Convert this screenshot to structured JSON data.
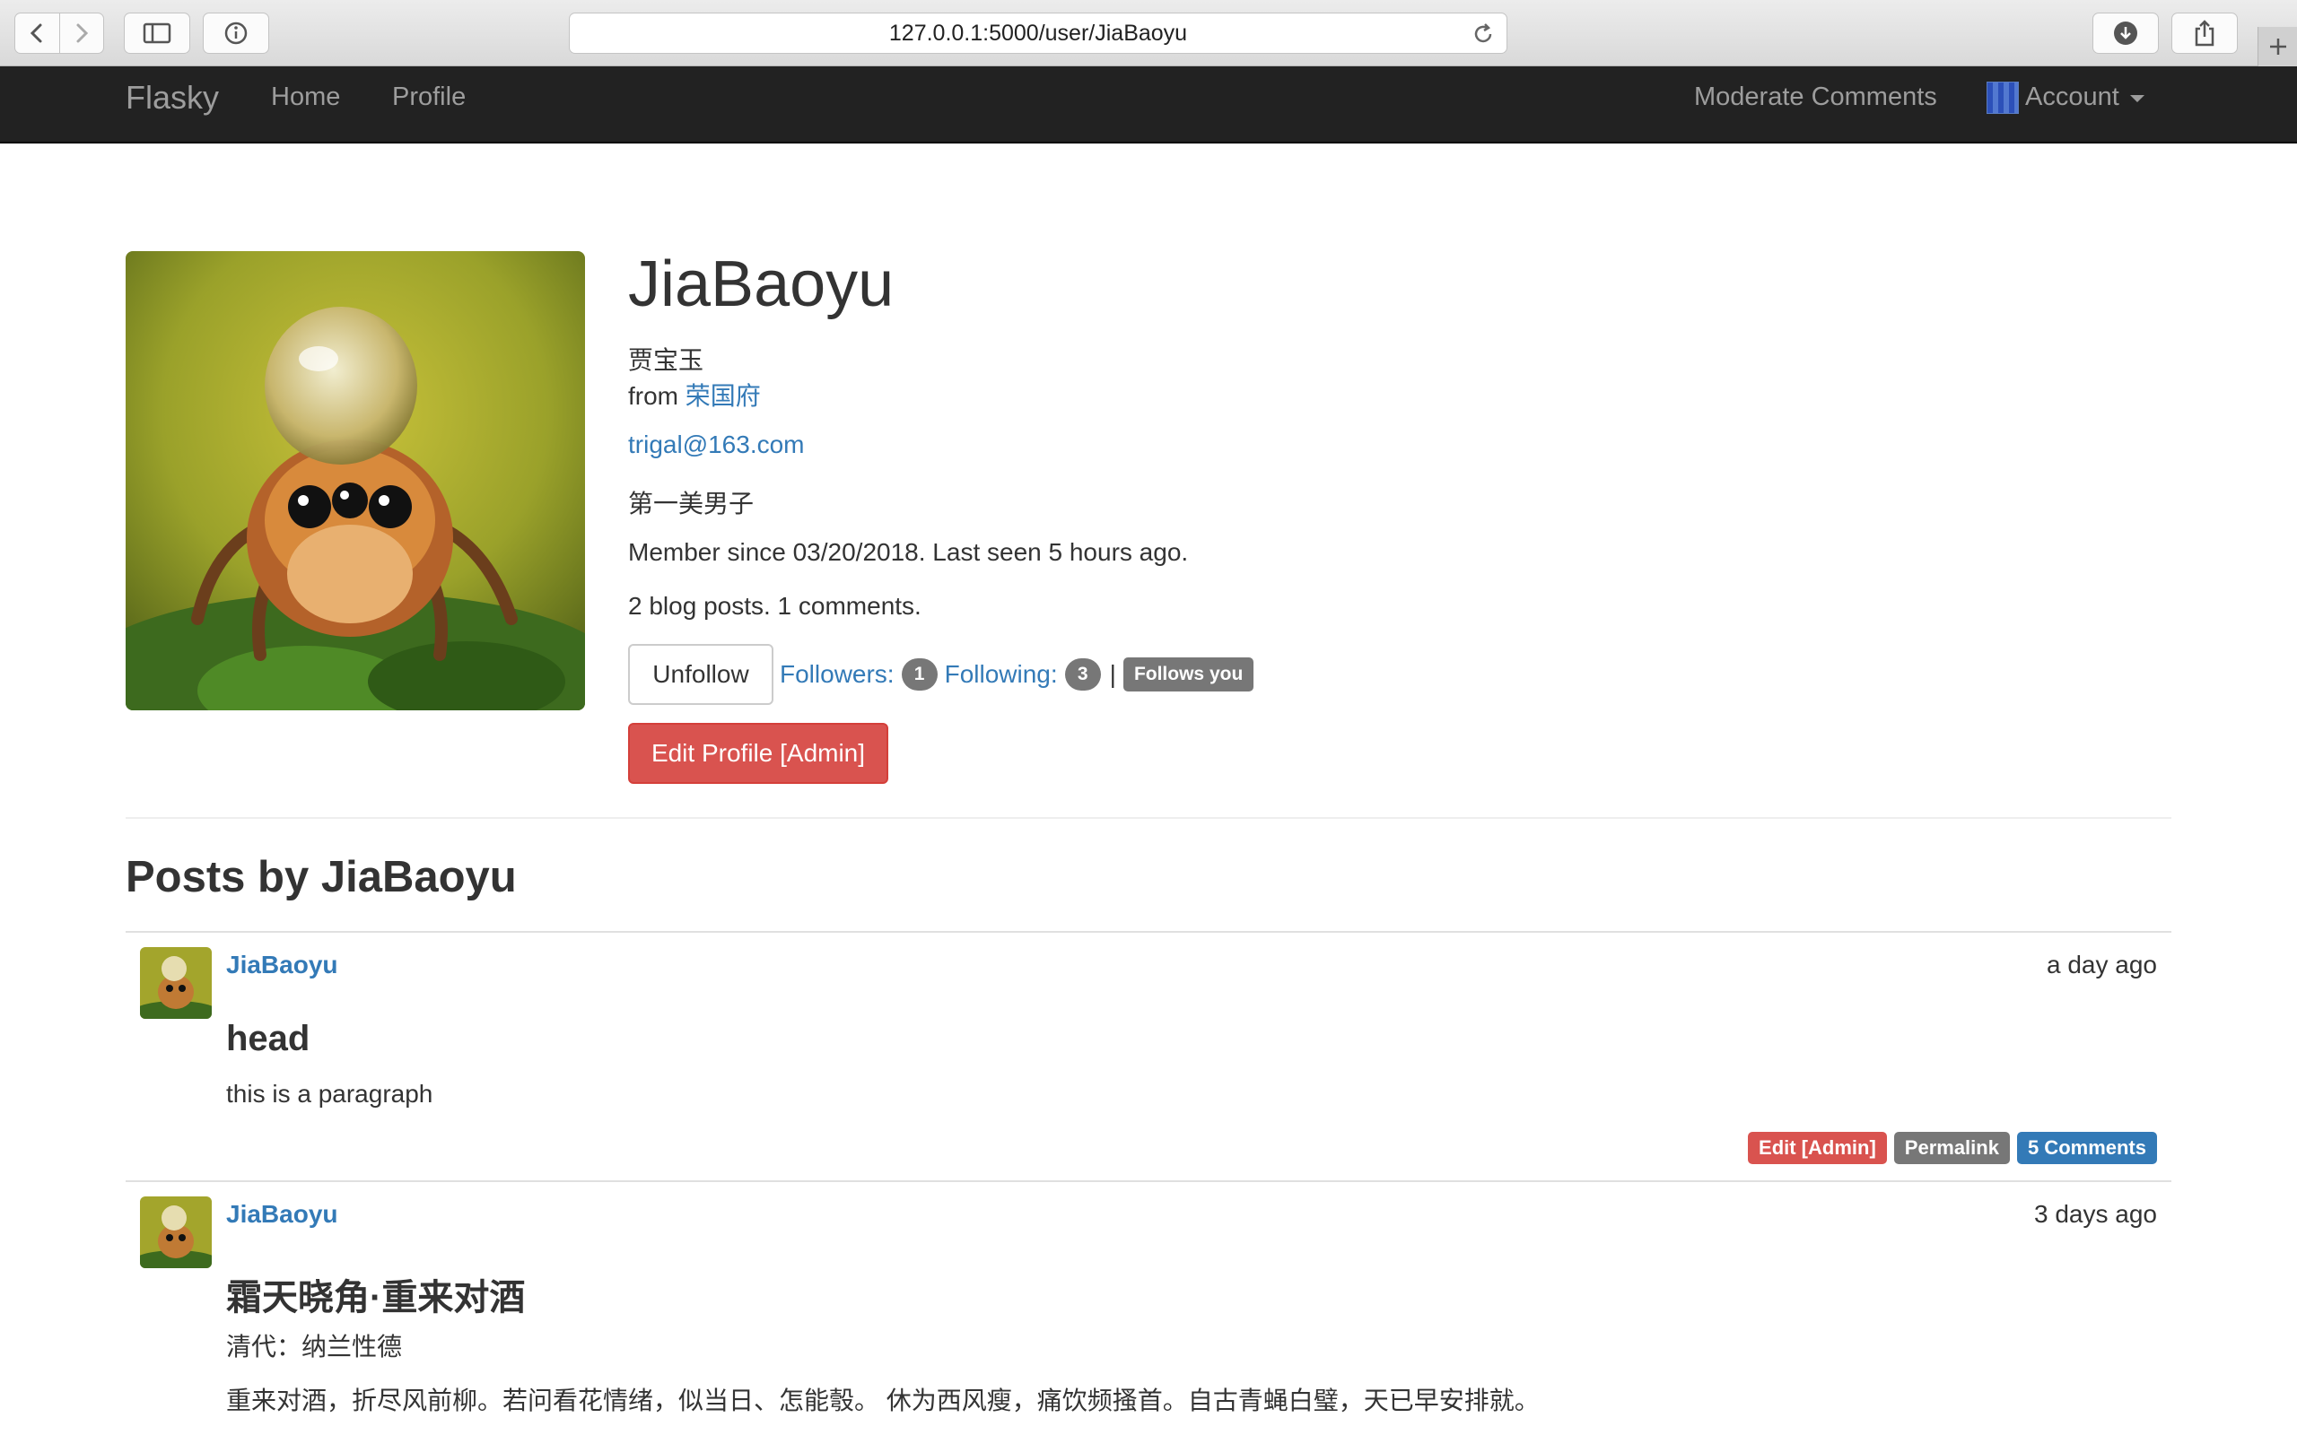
{
  "browser": {
    "url": "127.0.0.1:5000/user/JiaBaoyu"
  },
  "navbar": {
    "brand": "Flasky",
    "links": [
      "Home",
      "Profile"
    ],
    "moderate": "Moderate Comments",
    "account": "Account"
  },
  "profile": {
    "username": "JiaBaoyu",
    "name": "贾宝玉",
    "from_label": "from",
    "location": "荣国府",
    "email": "trigal@163.com",
    "about": "第一美男子",
    "member_info": "Member since 03/20/2018. Last seen 5 hours ago.",
    "counts": "2 blog posts. 1 comments.",
    "unfollow": "Unfollow",
    "followers_label": "Followers:",
    "followers_count": "1",
    "following_label": "Following:",
    "following_count": "3",
    "separator": "|",
    "follows_you": "Follows you",
    "edit_profile": "Edit Profile [Admin]"
  },
  "posts_heading": "Posts by JiaBaoyu",
  "posts": [
    {
      "author": "JiaBaoyu",
      "date": "a day ago",
      "title": "head",
      "body": [
        "this is a paragraph"
      ],
      "actions": {
        "edit": "Edit [Admin]",
        "permalink": "Permalink",
        "comments": "5 Comments"
      }
    },
    {
      "author": "JiaBaoyu",
      "date": "3 days ago",
      "title": "霜天晓角·重来对酒",
      "body": [
        "清代：纳兰性德",
        "重来对酒，折尽风前柳。若问看花情绪，似当日、怎能彀。 休为西风瘦，痛饮频搔首。自古青蝇白璧，天已早安排就。"
      ]
    }
  ],
  "colors": {
    "link": "#337ab7",
    "danger": "#d9534f",
    "badge": "#777777",
    "navbar": "#222222"
  }
}
